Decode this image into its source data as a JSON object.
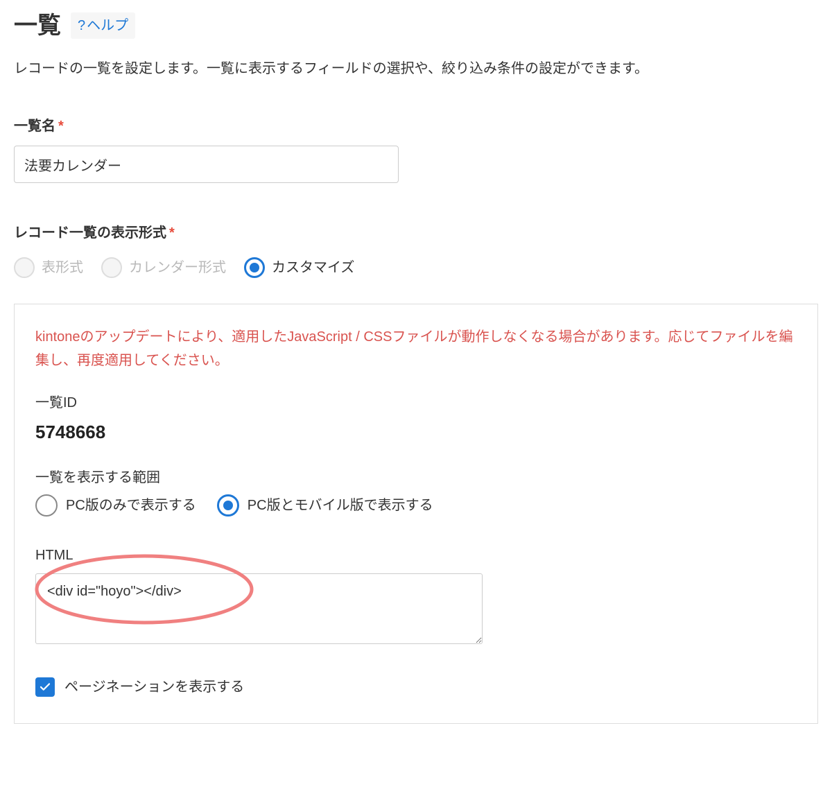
{
  "header": {
    "title": "一覧",
    "help_label": "ヘルプ"
  },
  "description": "レコードの一覧を設定します。一覧に表示するフィールドの選択や、絞り込み条件の設定ができます。",
  "list_name": {
    "label": "一覧名",
    "value": "法要カレンダー"
  },
  "display_format": {
    "label": "レコード一覧の表示形式",
    "options": {
      "table": "表形式",
      "calendar": "カレンダー形式",
      "custom": "カスタマイズ"
    }
  },
  "custom_panel": {
    "warning": "kintoneのアップデートにより、適用したJavaScript / CSSファイルが動作しなくなる場合があります。応じてファイルを編集し、再度適用してください。",
    "list_id_label": "一覧ID",
    "list_id_value": "5748668",
    "scope_label": "一覧を表示する範囲",
    "scope_options": {
      "pc_only": "PC版のみで表示する",
      "both": "PC版とモバイル版で表示する"
    },
    "html_label": "HTML",
    "html_value": "<div id=\"hoyo\"></div>",
    "pagination_label": "ページネーションを表示する"
  }
}
